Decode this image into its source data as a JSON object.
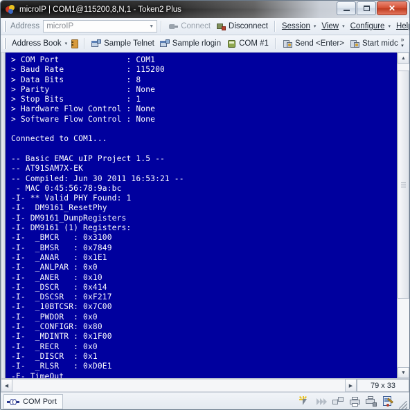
{
  "window": {
    "title": "microIP | COM1@115200,8,N,1 - Token2 Plus",
    "app_icon": "token2-app-icon",
    "minimize_label": "–",
    "maximize_label": "□",
    "close_label": "✕"
  },
  "toolbar_top": {
    "address_label": "Address",
    "address_value": "microIP",
    "address_placeholder": "microIP",
    "dropdown_arrow": "▼",
    "connect_label": "Connect",
    "disconnect_label": "Disconnect",
    "session_label": "Session",
    "view_label": "View",
    "configure_label": "Configure",
    "help_label": "Help",
    "caret": "▾"
  },
  "toolbar_second": {
    "address_book_label": "Address Book",
    "sample_telnet_label": "Sample Telnet",
    "sample_rlogin_label": "Sample rlogin",
    "com1_label": "COM #1",
    "send_enter_label": "Send <Enter>",
    "start_midc_label": "Start midc",
    "overflow_label": "»",
    "overflow_caret": "▾",
    "caret": "▾"
  },
  "terminal": {
    "background_color": "#00009e",
    "text_color": "#ffffff",
    "lines": [
      "> COM Port              : COM1",
      "> Baud Rate             : 115200",
      "> Data Bits             : 8",
      "> Parity                : None",
      "> Stop Bits             : 1",
      "> Hardware Flow Control : None",
      "> Software Flow Control : None",
      "",
      "Connected to COM1...",
      "",
      "-- Basic EMAC uIP Project 1.5 --",
      "-- AT91SAM7X-EK",
      "-- Compiled: Jun 30 2011 16:53:21 --",
      " - MAC 0:45:56:78:9a:bc",
      "-I- ** Valid PHY Found: 1",
      "-I-  DM9161_ResetPhy",
      "-I- DM9161_DumpRegisters",
      "-I- DM9161 (1) Registers:",
      "-I-  _BMCR   : 0x3100",
      "-I-  _BMSR   : 0x7849",
      "-I-  _ANAR   : 0x1E1",
      "-I-  _ANLPAR : 0x0",
      "-I-  _ANER   : 0x10",
      "-I-  _DSCR   : 0x414",
      "-I-  _DSCSR  : 0xF217",
      "-I-  _10BTCSR: 0x7C00",
      "-I-  _PWDOR  : 0x0",
      "-I-  _CONFIGR: 0x80",
      "-I-  _MDINTR : 0x1F00",
      "-I-  _RECR   : 0x0",
      "-I-  _DISCR  : 0x1",
      "-I-  _RLSR   : 0xD0E1",
      "-F- TimeOut"
    ]
  },
  "scrollbars": {
    "up_arrow": "▲",
    "down_arrow": "▼",
    "left_arrow": "◀",
    "right_arrow": "▶"
  },
  "size_indicator": {
    "value": "79 x 33"
  },
  "statusbar": {
    "tab_label": "COM Port",
    "tab_icon": "com-port-icon",
    "icons": [
      "highlight-cursor-icon",
      "fast-forward-icon",
      "share-icon",
      "print-icon",
      "print-setup-icon",
      "edit-log-icon"
    ]
  }
}
